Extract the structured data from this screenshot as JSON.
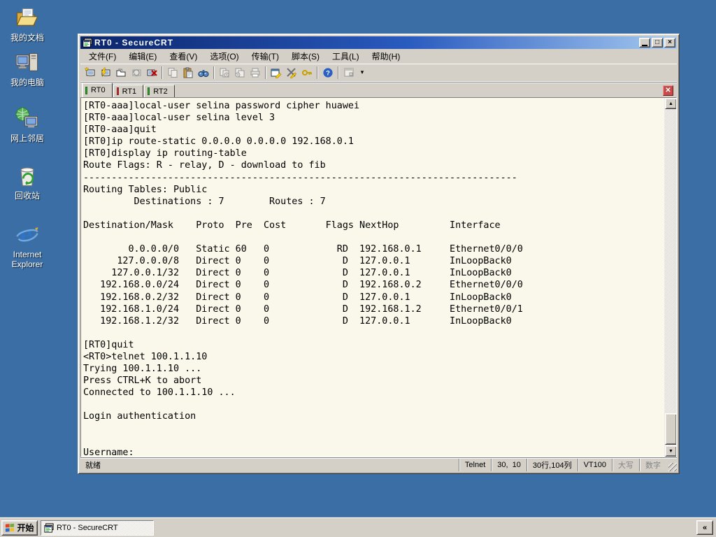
{
  "desktop": {
    "background_color": "#3A6EA5",
    "icons": [
      {
        "name": "my-documents",
        "label": "我的文档"
      },
      {
        "name": "my-computer",
        "label": "我的电脑"
      },
      {
        "name": "network-places",
        "label": "网上邻居"
      },
      {
        "name": "recycle-bin",
        "label": "回收站"
      },
      {
        "name": "internet-explorer",
        "label": "Internet Explorer"
      }
    ]
  },
  "window": {
    "title": "RT0 - SecureCRT",
    "menu": [
      "文件(F)",
      "编辑(E)",
      "查看(V)",
      "选项(O)",
      "传输(T)",
      "脚本(S)",
      "工具(L)",
      "帮助(H)"
    ],
    "toolbar_icons": [
      "connect",
      "quick-connect",
      "connect-in-tab",
      "reconnect",
      "disconnect",
      "copy",
      "paste",
      "find",
      "send-file",
      "receive-file",
      "print",
      "session-options",
      "global-options",
      "keymap",
      "help",
      "session-manager",
      "toolbar-overflow"
    ],
    "tabs": [
      {
        "label": "RT0",
        "state": "connected",
        "active": true
      },
      {
        "label": "RT1",
        "state": "disconnected",
        "active": false
      },
      {
        "label": "RT2",
        "state": "connected",
        "active": false
      }
    ],
    "tab_state_colors": {
      "connected": "#2FA52F",
      "disconnected": "#CC3333"
    },
    "terminal": {
      "background": "#FAF8EA",
      "text_color": "#000000",
      "lines": [
        "[RT0-aaa]local-user selina password cipher huawei",
        "[RT0-aaa]local-user selina level 3",
        "[RT0-aaa]quit",
        "[RT0]ip route-static 0.0.0.0 0.0.0.0 192.168.0.1",
        "[RT0]display ip routing-table",
        "Route Flags: R - relay, D - download to fib",
        "-----------------------------------------------------------------------------",
        "Routing Tables: Public",
        "         Destinations : 7        Routes : 7",
        "",
        "Destination/Mask    Proto  Pre  Cost       Flags NextHop         Interface",
        "",
        "        0.0.0.0/0   Static 60   0            RD  192.168.0.1     Ethernet0/0/0",
        "      127.0.0.0/8   Direct 0    0             D  127.0.0.1       InLoopBack0",
        "     127.0.0.1/32   Direct 0    0             D  127.0.0.1       InLoopBack0",
        "   192.168.0.0/24   Direct 0    0             D  192.168.0.2     Ethernet0/0/0",
        "   192.168.0.2/32   Direct 0    0             D  127.0.0.1       InLoopBack0",
        "   192.168.1.0/24   Direct 0    0             D  192.168.1.2     Ethernet0/0/1",
        "   192.168.1.2/32   Direct 0    0             D  127.0.0.1       InLoopBack0",
        "",
        "[RT0]quit",
        "<RT0>telnet 100.1.1.10",
        "Trying 100.1.1.10 ...",
        "Press CTRL+K to abort",
        "Connected to 100.1.1.10 ...",
        "",
        "Login authentication",
        "",
        "",
        "Username:"
      ]
    },
    "statusbar": {
      "ready_text": "就绪",
      "protocol": "Telnet",
      "cursor": "30,  10",
      "grid": "30行,104列",
      "emulation": "VT100",
      "caps_label": "大写",
      "num_label": "数字"
    }
  },
  "taskbar": {
    "start_label": "开始",
    "task_button_label": "RT0 - SecureCRT",
    "tray_expander": "«"
  }
}
